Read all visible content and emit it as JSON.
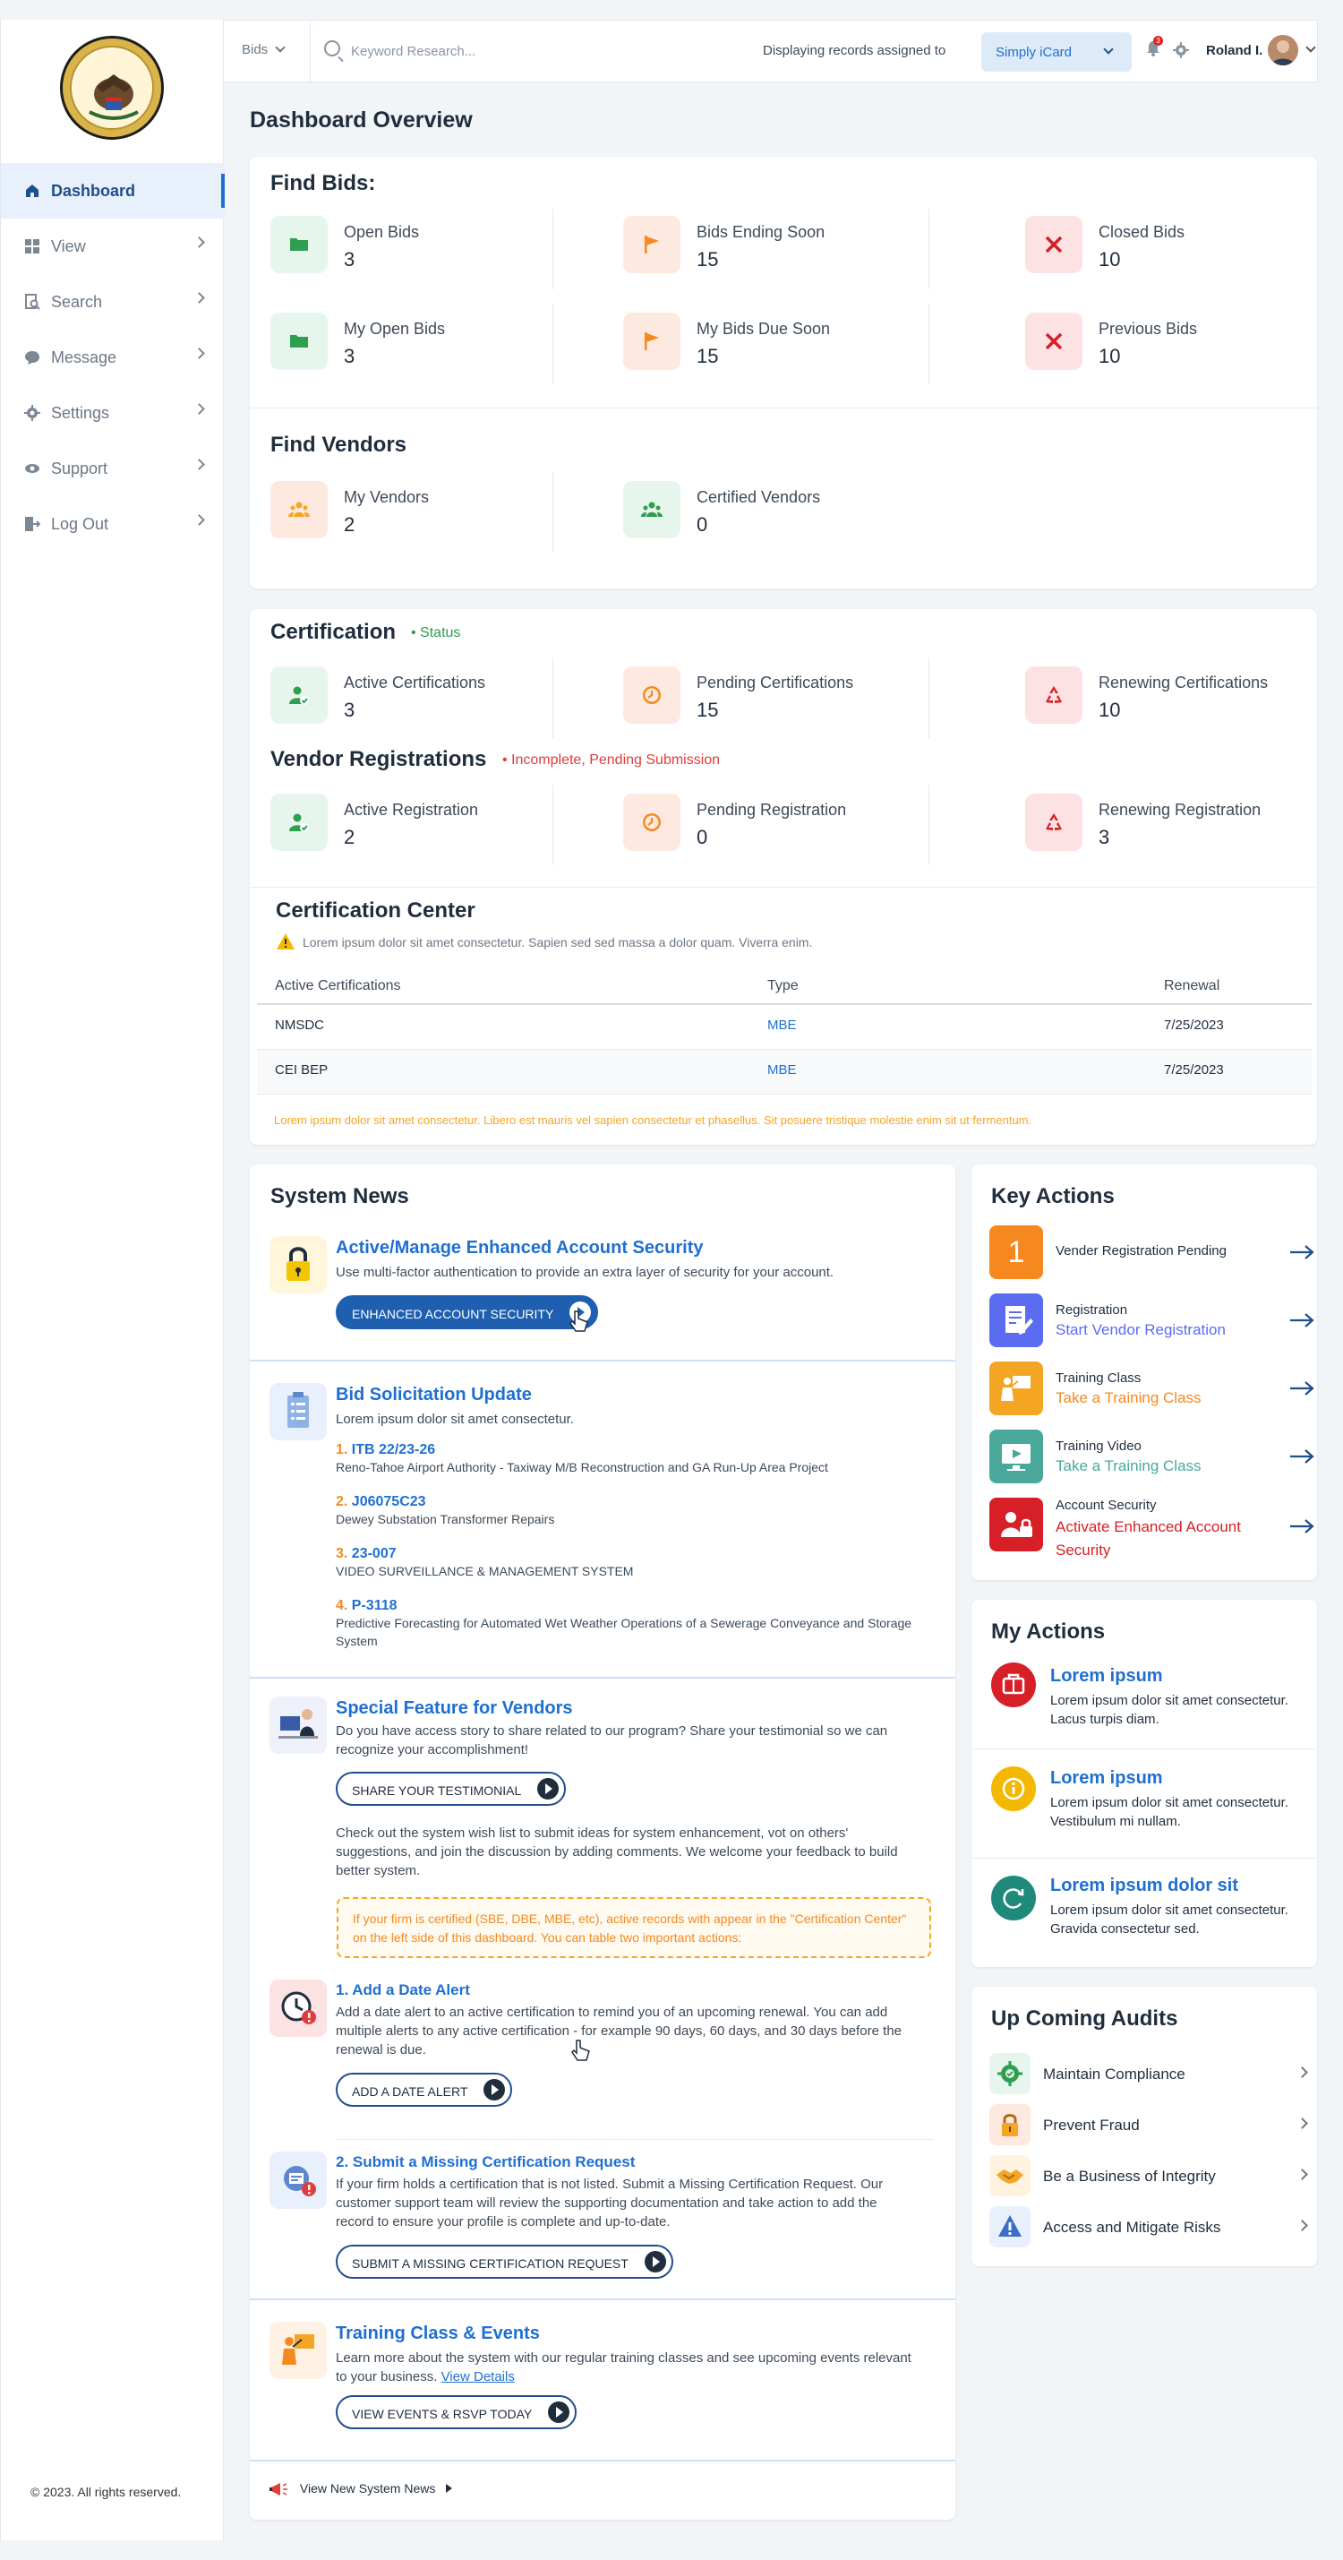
{
  "sidebar": {
    "items": [
      {
        "label": "Dashboard",
        "icon": "home-icon"
      },
      {
        "label": "View",
        "icon": "grid-icon"
      },
      {
        "label": "Search",
        "icon": "search-doc-icon"
      },
      {
        "label": "Message",
        "icon": "chat-icon"
      },
      {
        "label": "Settings",
        "icon": "gear-icon"
      },
      {
        "label": "Support",
        "icon": "eye-icon"
      },
      {
        "label": "Log Out",
        "icon": "logout-icon"
      }
    ],
    "copyright": "© 2023. All rights reserved."
  },
  "topbar": {
    "bids_label": "Bids",
    "search_placeholder": "Keyword Research...",
    "assigned_text": "Displaying records assigned to",
    "org": "Simply iCard",
    "notification_count": "3",
    "user_name": "Roland I."
  },
  "page_title": "Dashboard Overview",
  "find_bids": {
    "title": "Find Bids:",
    "stats": [
      {
        "label": "Open Bids",
        "value": "3"
      },
      {
        "label": "Bids Ending Soon",
        "value": "15"
      },
      {
        "label": "Closed Bids",
        "value": "10"
      },
      {
        "label": "My Open Bids",
        "value": "3"
      },
      {
        "label": "My Bids Due Soon",
        "value": "15"
      },
      {
        "label": "Previous Bids",
        "value": "10"
      }
    ]
  },
  "find_vendors": {
    "title": "Find Vendors",
    "stats": [
      {
        "label": "My Vendors",
        "value": "2"
      },
      {
        "label": "Certified Vendors",
        "value": "0"
      }
    ]
  },
  "certification": {
    "title": "Certification",
    "status": "• Status",
    "stats": [
      {
        "label": "Active Certifications",
        "value": "3"
      },
      {
        "label": "Pending Certifications",
        "value": "15"
      },
      {
        "label": "Renewing Certifications",
        "value": "10"
      }
    ]
  },
  "vendor_registrations": {
    "title": "Vendor Registrations",
    "status": "• Incomplete, Pending Submission",
    "stats": [
      {
        "label": "Active Registration",
        "value": "2"
      },
      {
        "label": "Pending Registration",
        "value": "0"
      },
      {
        "label": "Renewing Registration",
        "value": "3"
      }
    ]
  },
  "cert_center": {
    "title": "Certification Center",
    "note": "Lorem ipsum dolor sit amet consectetur. Sapien sed sed massa a dolor quam. Viverra enim.",
    "headers": [
      "Active Certifications",
      "Type",
      "Renewal"
    ],
    "rows": [
      [
        "NMSDC",
        "MBE",
        "7/25/2023"
      ],
      [
        "CEI BEP",
        "MBE",
        "7/25/2023"
      ]
    ],
    "footer": "Lorem ipsum dolor sit amet consectetur. Libero est mauris vel sapien consectetur et phasellus. Sit posuere tristique molestie enim sit ut fermentum."
  },
  "system_news": {
    "title": "System News",
    "security": {
      "title": "Active/Manage Enhanced Account Security",
      "desc": "Use multi-factor authentication to provide an extra layer of security for your account.",
      "button": "ENHANCED ACCOUNT SECURITY"
    },
    "bid_update": {
      "title": "Bid Solicitation Update",
      "desc": "Lorem ipsum dolor sit amet consectetur.",
      "items": [
        {
          "num": "1.",
          "code": "ITB 22/23-26",
          "desc": "Reno-Tahoe Airport Authority - Taxiway M/B Reconstruction and GA Run-Up Area Project"
        },
        {
          "num": "2.",
          "code": "J06075C23",
          "desc": "Dewey Substation Transformer Repairs"
        },
        {
          "num": "3.",
          "code": "23-007",
          "desc": "VIDEO SURVEILLANCE & MANAGEMENT SYSTEM"
        },
        {
          "num": "4.",
          "code": "P-3118",
          "desc": "Predictive Forecasting for Automated Wet Weather Operations of a Sewerage Conveyance and Storage System"
        }
      ]
    },
    "special": {
      "title": "Special Feature for Vendors",
      "desc": "Do you have access story to share related to our program? Share your testimonial so we can recognize your accomplishment!",
      "button": "SHARE YOUR TESTIMONIAL",
      "desc2": "Check out the system wish list to submit ideas for system enhancement, vot on others' suggestions, and join the discussion by adding comments. We welcome your feedback to build better system.",
      "notice": "If your firm is certified (SBE, DBE, MBE, etc), active records with appear in the \"Certification Center\" on the left side of this dashboard. You can table two important actions:"
    },
    "date_alert": {
      "title": "1. Add a Date Alert",
      "desc": "Add a date alert to an active certification to remind you of an upcoming renewal. You can add multiple alerts to any active certification - for example 90 days, 60 days, and 30 days before the renewal is due.",
      "button": "ADD A DATE ALERT"
    },
    "missing_cert": {
      "title": "2. Submit a Missing Certification Request",
      "desc": "If your firm holds a certification that is not listed. Submit a Missing Certification Request. Our customer support team will review the supporting documentation and take action to add the record to ensure your profile is complete and up-to-date.",
      "button": "SUBMIT A MISSING CERTIFICATION REQUEST"
    },
    "training": {
      "title": "Training Class & Events",
      "desc": "Learn more about the system with our regular training classes and see upcoming events relevant to your business.",
      "link": "View Details",
      "button": "VIEW EVENTS & RSVP TODAY"
    },
    "view_new": "View New System News"
  },
  "key_actions": {
    "title": "Key Actions",
    "items": [
      {
        "line1": "Vender Registration Pending",
        "line2": "",
        "badge": "1",
        "color": "#f5891f"
      },
      {
        "line1": "Registration",
        "line2": "Start Vendor Registration",
        "color": "#5b6cf0"
      },
      {
        "line1": "Training Class",
        "line2": "Take a Training Class",
        "color": "#f5a524"
      },
      {
        "line1": "Training Video",
        "line2": "Take a Training Class",
        "color": "#4aa89a"
      },
      {
        "line1": "Account Security",
        "line2": "Activate Enhanced Account Security",
        "color": "#d61f26"
      }
    ]
  },
  "my_actions": {
    "title": "My Actions",
    "items": [
      {
        "title": "Lorem ipsum",
        "desc": "Lorem ipsum dolor sit amet consectetur. Lacus turpis diam."
      },
      {
        "title": "Lorem ipsum",
        "desc": "Lorem ipsum dolor sit amet consectetur. Vestibulum mi nullam."
      },
      {
        "title": "Lorem ipsum dolor sit",
        "desc": "Lorem ipsum dolor sit amet consectetur. Gravida consectetur sed."
      }
    ]
  },
  "audits": {
    "title": "Up Coming Audits",
    "items": [
      {
        "label": "Maintain Compliance"
      },
      {
        "label": "Prevent Fraud"
      },
      {
        "label": "Be a Business of Integrity"
      },
      {
        "label": "Access and Mitigate Risks"
      }
    ]
  }
}
